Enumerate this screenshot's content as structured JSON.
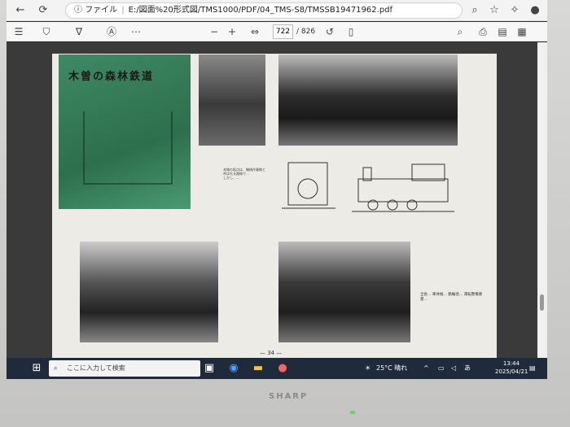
{
  "browser": {
    "url_prefix": "ファイル",
    "url": "E:/図面%20形式図/TMS1000/PDF/04_TMS-S8/TMSSB19471962.pdf",
    "back_icon": "arrow-left",
    "refresh_icon": "refresh"
  },
  "pdf_toolbar": {
    "page_current": "722",
    "page_total": "/ 826",
    "zoom_minus": "−",
    "zoom_plus": "+"
  },
  "page": {
    "title": "木曽の森林鉄道",
    "page_number": "— 34 —",
    "caption_block": "本線の起点は、機械作業線と\n呼ばれる路線で…\nしかし、…",
    "specs": "全長…\n車体幅…\n動輪径…\n運転整備重量…"
  },
  "taskbar": {
    "search_placeholder": "ここに入力して検索",
    "weather": "25°C 晴れ",
    "time": "13:44",
    "date": "2025/04/21",
    "ime": "あ"
  },
  "monitor": {
    "brand": "SHARP"
  }
}
